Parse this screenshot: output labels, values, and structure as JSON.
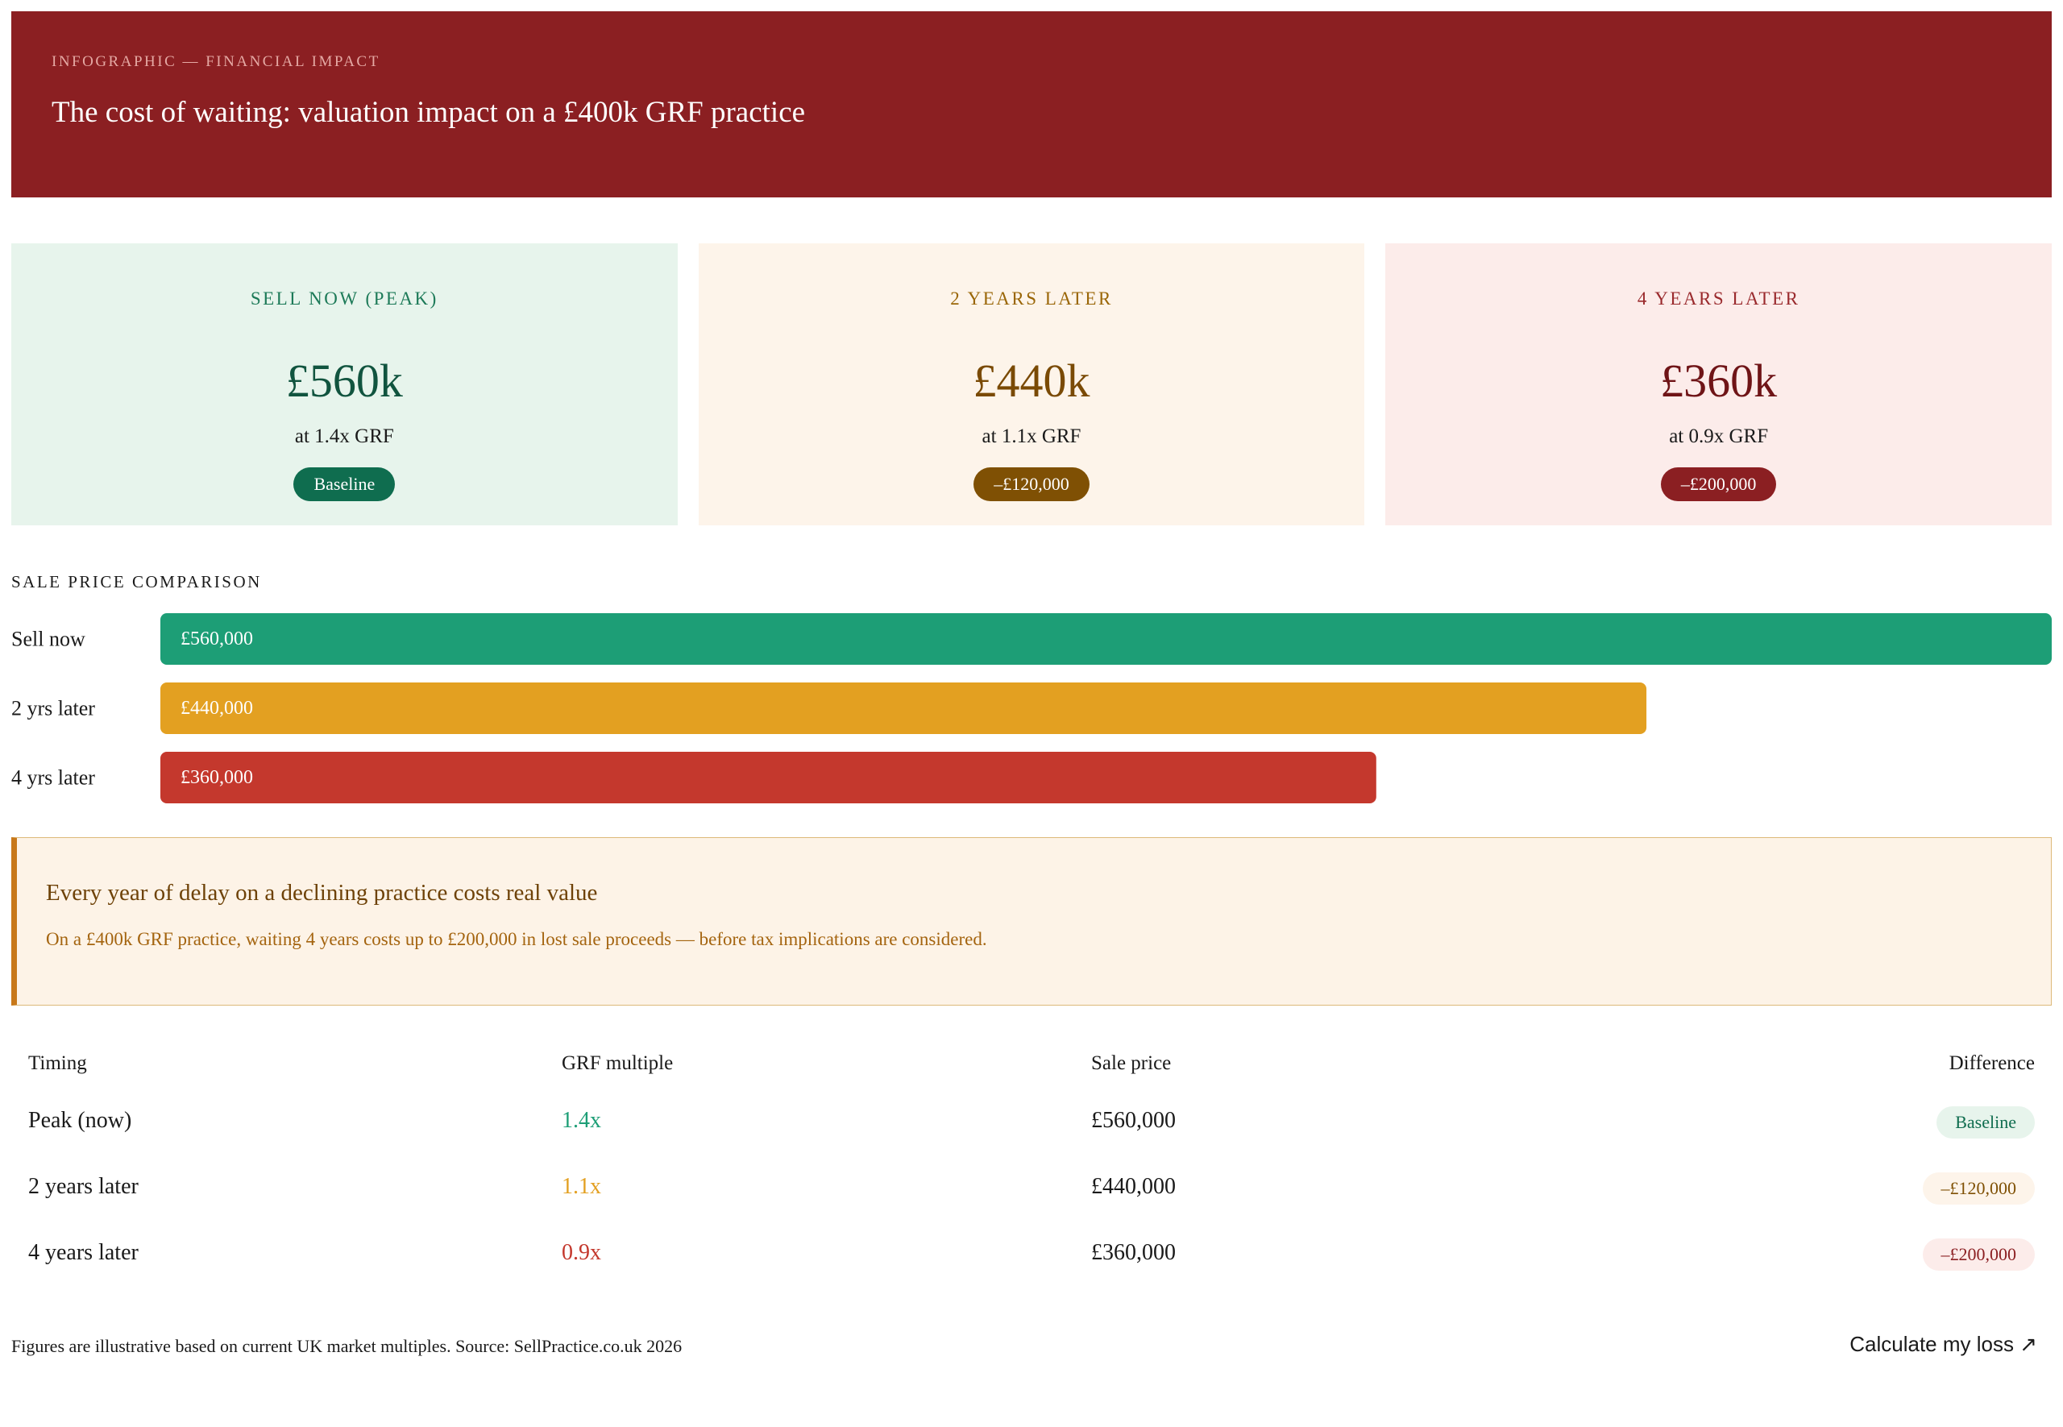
{
  "header": {
    "kicker": "INFOGRAPHIC — FINANCIAL IMPACT",
    "title": "The cost of waiting: valuation impact on a £400k GRF practice"
  },
  "cards": [
    {
      "label": "SELL NOW (PEAK)",
      "value": "£560k",
      "sub": "at 1.4x GRF",
      "badge": "Baseline"
    },
    {
      "label": "2 YEARS LATER",
      "value": "£440k",
      "sub": "at 1.1x GRF",
      "badge": "–£120,000"
    },
    {
      "label": "4 YEARS LATER",
      "value": "£360k",
      "sub": "at 0.9x GRF",
      "badge": "–£200,000"
    }
  ],
  "chart_title": "SALE PRICE COMPARISON",
  "chart_data": {
    "type": "bar",
    "orientation": "horizontal",
    "categories": [
      "Sell now",
      "2 yrs later",
      "4 yrs later"
    ],
    "values": [
      560000,
      440000,
      360000
    ],
    "value_labels": [
      "£560,000",
      "£440,000",
      "£360,000"
    ],
    "colors": [
      "#1d9e76",
      "#e3a021",
      "#c4382d"
    ],
    "title": "",
    "xlabel": "",
    "ylabel": "",
    "xlim": [
      0,
      560000
    ]
  },
  "callout": {
    "title": "Every year of delay on a declining practice costs real value",
    "text": "On a £400k GRF practice, waiting 4 years costs up to £200,000 in lost sale proceeds — before tax implications are considered."
  },
  "table": {
    "headers": [
      "Timing",
      "GRF multiple",
      "Sale price",
      "Difference"
    ],
    "rows": [
      {
        "timing": "Peak (now)",
        "multiple": "1.4x",
        "price": "£560,000",
        "difference": "Baseline"
      },
      {
        "timing": "2 years later",
        "multiple": "1.1x",
        "price": "£440,000",
        "difference": "–£120,000"
      },
      {
        "timing": "4 years later",
        "multiple": "0.9x",
        "price": "£360,000",
        "difference": "–£200,000"
      }
    ]
  },
  "footer": {
    "note": "Figures are illustrative based on current UK market multiples. Source: SellPractice.co.uk 2026",
    "cta": "Calculate my loss ↗"
  }
}
